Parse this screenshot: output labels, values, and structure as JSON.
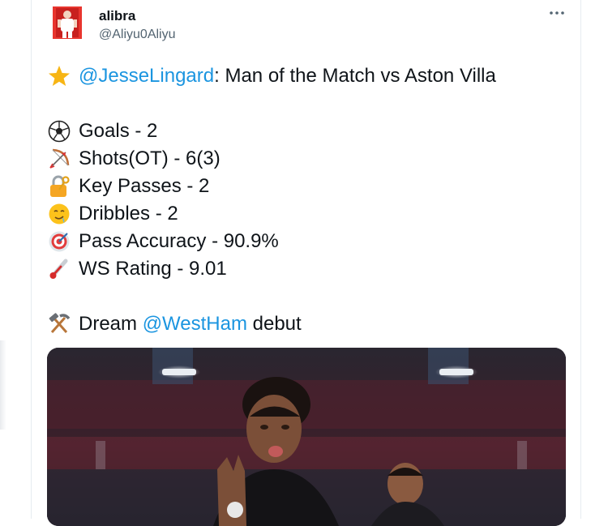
{
  "author": {
    "display_name": "alibra",
    "handle": "@Aliyu0Aliyu"
  },
  "tweet": {
    "line1": {
      "mention": "@JesseLingard",
      "text": ": Man of the Match vs Aston Villa"
    },
    "stats": [
      {
        "icon": "soccer-ball-icon",
        "text": "Goals - 2"
      },
      {
        "icon": "bow-and-arrow-icon",
        "text": "Shots(OT) - 6(3)"
      },
      {
        "icon": "lock-with-key-icon",
        "text": "Key Passes - 2"
      },
      {
        "icon": "drooling-face-icon",
        "text": "Dribbles - 2"
      },
      {
        "icon": "target-icon",
        "text": "Pass Accuracy - 90.9%"
      },
      {
        "icon": "thermometer-icon",
        "text": "WS Rating - 9.01"
      }
    ],
    "closing": {
      "prefix": "Dream ",
      "mention": "@WestHam",
      "suffix": " debut"
    }
  },
  "colors": {
    "mention": "#1b95e0",
    "secondary_text": "#536471"
  }
}
